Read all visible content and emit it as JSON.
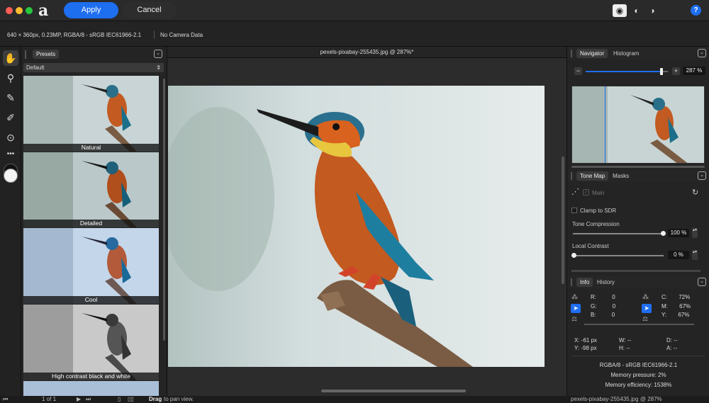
{
  "toolbar": {
    "apply_label": "Apply",
    "cancel_label": "Cancel",
    "logo_glyph": "a",
    "help_label": "?"
  },
  "info_bar": {
    "image_info": "640 × 360px, 0.23MP, RGBA/8 - sRGB IEC61966-2.1",
    "camera_info": "No Camera Data"
  },
  "presets": {
    "tab_label": "Presets",
    "dropdown_value": "Default",
    "items": [
      {
        "label": "Natural"
      },
      {
        "label": "Detailed"
      },
      {
        "label": "Cool"
      },
      {
        "label": "High contrast black and white"
      }
    ]
  },
  "canvas": {
    "document_title": "pexels-pixabay-255435.jpg @ 287%*"
  },
  "navigator": {
    "tabs": [
      "Navigator",
      "Histogram"
    ],
    "zoom_value": "287 %",
    "zoom_level": 0.92,
    "minus_label": "−",
    "plus_label": "+"
  },
  "tone_map": {
    "tabs": [
      "Tone Map",
      "Masks"
    ],
    "main_label": "Main",
    "clamp_label": "Clamp to SDR",
    "tone_compression_label": "Tone Compression",
    "tone_compression_value": "100 %",
    "tone_compression_level": 1.0,
    "local_contrast_label": "Local Contrast",
    "local_contrast_value": "0 %",
    "local_contrast_level": 0.0
  },
  "info_panel": {
    "tabs": [
      "Info",
      "History"
    ],
    "rgb": [
      {
        "k": "R:",
        "v": "0"
      },
      {
        "k": "G:",
        "v": "0"
      },
      {
        "k": "B:",
        "v": "0"
      }
    ],
    "cmyk": [
      {
        "k": "C:",
        "v": "72%"
      },
      {
        "k": "M:",
        "v": "67%"
      },
      {
        "k": "Y:",
        "v": "67%"
      }
    ],
    "x": "X: -61 px",
    "y": "Y: -98 px",
    "w": "W: --",
    "h": "H: --",
    "d": "D: --",
    "a": "A: --",
    "color_profile": "RGBA/8 - sRGB IEC61966-2.1",
    "memory_pressure": "Memory pressure: 2%",
    "memory_efficiency": "Memory efficiency: 1538%"
  },
  "status_bar": {
    "page": "1 of 1",
    "hint_bold": "Drag",
    "hint_rest": " to pan view.",
    "right_text": "pexels-pixabay-255435.jpg @ 287%"
  },
  "colors": {
    "accent": "#1e6ef0",
    "close": "#ff5f57",
    "minimize": "#febc2e",
    "maximize": "#28c840"
  }
}
